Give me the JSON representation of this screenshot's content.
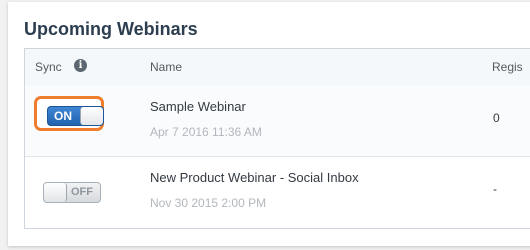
{
  "section": {
    "title": "Upcoming Webinars"
  },
  "table": {
    "headers": {
      "sync": "Sync",
      "name": "Name",
      "registrants": "Regis"
    },
    "rows": [
      {
        "sync_label": "ON",
        "sync_enabled": true,
        "name": "Sample Webinar",
        "date": "Apr 7 2016 11:36 AM",
        "registrants": "0"
      },
      {
        "sync_label": "OFF",
        "sync_enabled": false,
        "name": "New Product Webinar - Social Inbox",
        "date": "Nov 30 2015 2:00 PM",
        "registrants": "-"
      }
    ]
  },
  "icons": {
    "info": "info-icon"
  },
  "colors": {
    "highlight": "#ef7d2b",
    "toggle_on": "#2f74c0",
    "title": "#2d3e50"
  }
}
